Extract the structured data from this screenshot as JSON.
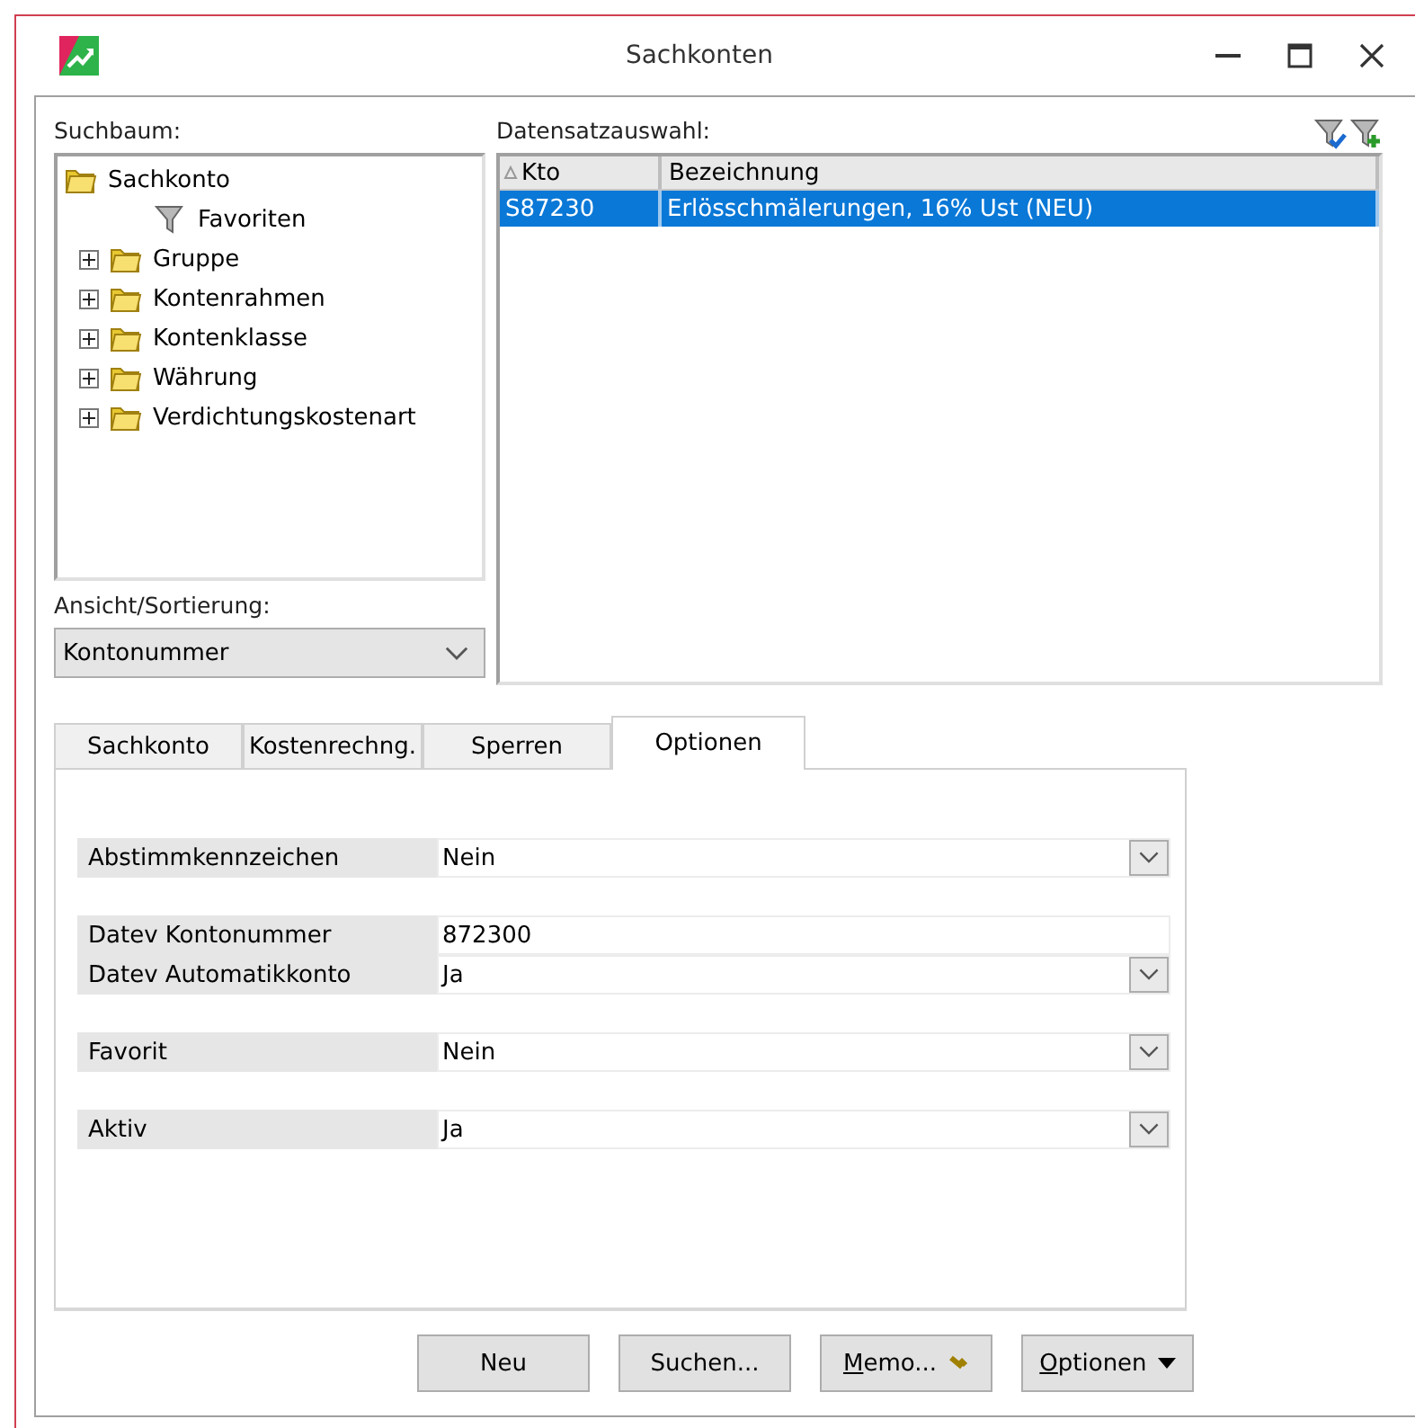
{
  "window": {
    "title": "Sachkonten"
  },
  "search_tree": {
    "label": "Suchbaum:",
    "items": [
      {
        "label": "Sachkonto",
        "kind": "folder",
        "children": [
          {
            "label": "Favoriten",
            "kind": "filter"
          }
        ]
      },
      {
        "label": "Gruppe",
        "kind": "folder",
        "expanded": false
      },
      {
        "label": "Kontenrahmen",
        "kind": "folder",
        "expanded": false
      },
      {
        "label": "Kontenklasse",
        "kind": "folder",
        "expanded": false
      },
      {
        "label": "Währung",
        "kind": "folder",
        "expanded": false
      },
      {
        "label": "Verdichtungskostenart",
        "kind": "folder",
        "expanded": false
      }
    ]
  },
  "view_sort": {
    "label": "Ansicht/Sortierung:",
    "value": "Kontonummer"
  },
  "record_selection": {
    "label": "Datensatzauswahl:",
    "columns": [
      "Kto",
      "Bezeichnung"
    ],
    "rows": [
      {
        "cells": [
          "S87230",
          "Erlösschmälerungen, 16% Ust (NEU)"
        ],
        "selected": true
      }
    ]
  },
  "tabs": [
    {
      "label": "Sachkonto",
      "selected": false
    },
    {
      "label": "Kostenrechng.",
      "selected": false
    },
    {
      "label": "Sperren",
      "selected": false
    },
    {
      "label": "Optionen",
      "selected": true
    }
  ],
  "option_groups": [
    [
      {
        "label": "Abstimmkennzeichen",
        "value": "Nein",
        "kind": "dropdown"
      }
    ],
    [
      {
        "label": "Datev Kontonummer",
        "value": "872300",
        "kind": "text"
      },
      {
        "label": "Datev Automatikkonto",
        "value": "Ja",
        "kind": "dropdown"
      }
    ],
    [
      {
        "label": "Favorit",
        "value": "Nein",
        "kind": "dropdown"
      }
    ],
    [
      {
        "label": "Aktiv",
        "value": "Ja",
        "kind": "dropdown"
      }
    ]
  ],
  "buttons": [
    {
      "label": "Neu",
      "kind": "plain"
    },
    {
      "label": "Suchen...",
      "kind": "plain"
    },
    {
      "label": "Memo...",
      "kind": "memo",
      "mnemonic": true
    },
    {
      "label": "Optionen",
      "kind": "menu",
      "mnemonic": true
    }
  ]
}
